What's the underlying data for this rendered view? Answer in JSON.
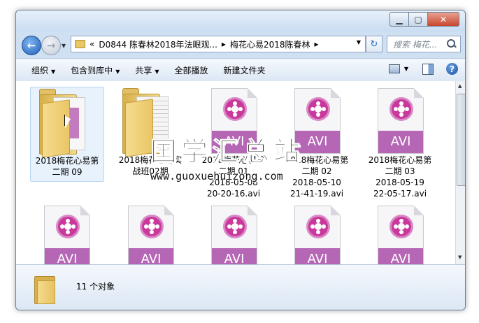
{
  "address": {
    "prefix": "«",
    "segments": [
      "D0844 陈春林2018年法眼观...",
      "梅花心易2018陈春林"
    ],
    "separator": "▸"
  },
  "search": {
    "placeholder": "搜索 梅花..."
  },
  "toolbar": {
    "organize": "组织",
    "include_library": "包含到库中",
    "share": "共享",
    "play_all": "全部播放",
    "new_folder": "新建文件夹"
  },
  "items": [
    {
      "type": "folder",
      "line1": "2018梅花心易第",
      "line2": "二期 09",
      "line3": "",
      "line4": ""
    },
    {
      "type": "docfolder",
      "line1": "2018梅花心易实",
      "line2": "战班02期",
      "line3": "",
      "line4": ""
    },
    {
      "type": "avi",
      "badge": "AVI",
      "line1": "2018梅花心易第",
      "line2": "二期 01",
      "line3": "2018-05-08",
      "line4": "20-20-16.avi"
    },
    {
      "type": "avi",
      "badge": "AVI",
      "line1": "2018梅花心易第",
      "line2": "二期 02",
      "line3": "2018-05-10",
      "line4": "21-41-19.avi"
    },
    {
      "type": "avi",
      "badge": "AVI",
      "line1": "2018梅花心易第",
      "line2": "二期 03",
      "line3": "2018-05-19",
      "line4": "22-05-17.avi"
    },
    {
      "type": "avi",
      "badge": "AVI"
    },
    {
      "type": "avi",
      "badge": "AVI"
    },
    {
      "type": "avi",
      "badge": "AVI"
    },
    {
      "type": "avi",
      "badge": "AVI"
    },
    {
      "type": "avi",
      "badge": "AVI"
    }
  ],
  "status": {
    "count": "11 个对象"
  },
  "watermark": {
    "title": "国学汇总站",
    "url": "www.guoxuehuizong.com"
  },
  "colors": {
    "accent": "#1f5fb9",
    "avi_band": "#b566b5",
    "folder": "#e8c766"
  },
  "icons": {
    "back": "back-arrow-icon",
    "forward": "forward-arrow-icon",
    "refresh": "refresh-icon",
    "search": "search-icon",
    "help": "help-icon"
  }
}
